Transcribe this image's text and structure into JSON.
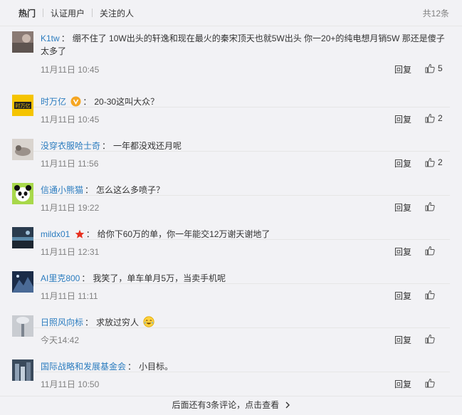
{
  "tabs": {
    "hot": "热门",
    "verified": "认证用户",
    "following": "关注的人",
    "total": "共12条"
  },
  "reply_label": "回复",
  "comments": [
    {
      "user": "K1tw",
      "text": "绷不住了 10W出头的轩逸和现在最火的秦宋顶天也就5W出头 你一20+的纯电想月销5W 那还是傻子",
      "text2": "太多了",
      "time": "11月11日 10:45",
      "likes": "5"
    },
    {
      "user": "时万亿",
      "text": "20-30这叫大众？",
      "time": "11月11日 10:45",
      "likes": "2"
    },
    {
      "user": "没穿衣服哈士奇",
      "text": "一年都没戏还月呢",
      "time": "11月11日 11:56",
      "likes": "2"
    },
    {
      "user": "信通小熊猫",
      "text": "怎么这么多喷子？",
      "time": "11月11日 19:22",
      "likes": ""
    },
    {
      "user": "mildx01",
      "text": "给你下60万的单，你一年能交12万谢天谢地了",
      "time": "11月11日 12:31",
      "likes": ""
    },
    {
      "user": "AI里克800",
      "text": "我笑了，单车单月5万，当卖手机呢",
      "time": "11月11日 11:11",
      "likes": ""
    },
    {
      "user": "日照风向标",
      "text": "求放过穷人",
      "time": "今天14:42",
      "likes": ""
    },
    {
      "user": "国际战略和发展基金会",
      "text": "小目标。",
      "time": "11月11日 10:50",
      "likes": ""
    }
  ],
  "more": "后面还有3条评论，点击查看",
  "colors": {
    "link": "#2b7cbf",
    "muted": "#808080",
    "text": "#333333"
  }
}
